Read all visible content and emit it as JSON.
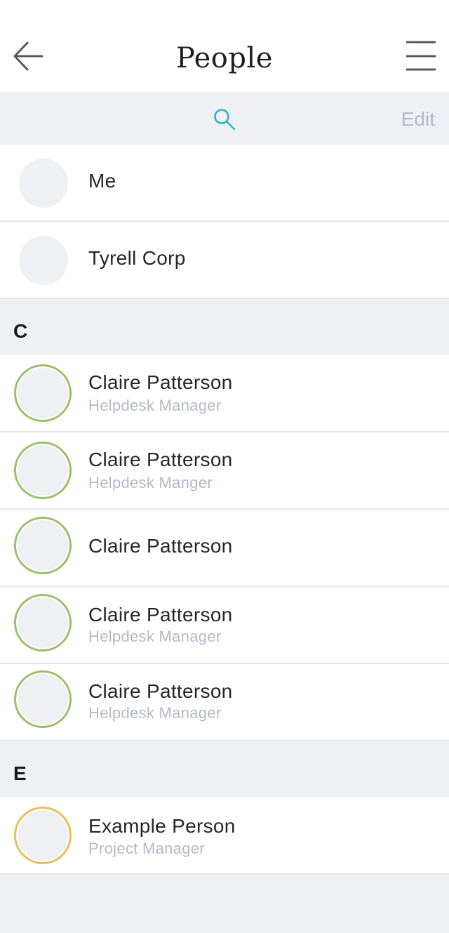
{
  "header": {
    "title": "People",
    "back_icon": "arrow-left-icon",
    "menu_icon": "hamburger-menu-icon"
  },
  "toolbar": {
    "search_icon": "search-icon",
    "edit_label": "Edit"
  },
  "pinned": [
    {
      "name": "Me"
    },
    {
      "name": "Tyrell Corp"
    }
  ],
  "sections": [
    {
      "letter": "C",
      "people": [
        {
          "name": "Claire Patterson",
          "role": "Helpdesk Manager"
        },
        {
          "name": "Claire Patterson",
          "role": "Helpdesk Manger"
        },
        {
          "name": "Claire Patterson",
          "role": ""
        },
        {
          "name": "Claire Patterson",
          "role": "Helpdesk Manager"
        },
        {
          "name": "Claire Patterson",
          "role": "Helpdesk Manager"
        }
      ]
    },
    {
      "letter": "E",
      "people": [
        {
          "name": "Example Person",
          "role": "Project Manager"
        }
      ]
    }
  ],
  "colors": {
    "accent": "#2fb3c8",
    "ring_green": "#9bc06a",
    "ring_amber": "#eabf55",
    "muted_text": "#b3b9c6",
    "background": "#eff0f4"
  }
}
